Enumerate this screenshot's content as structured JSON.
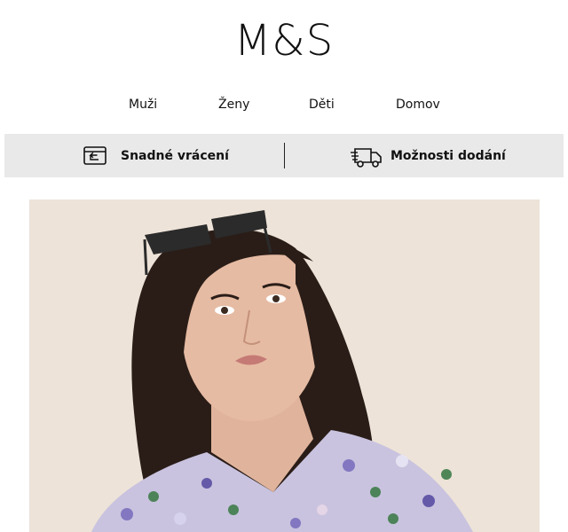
{
  "header": {
    "logo_text": "M&S"
  },
  "nav": {
    "items": [
      "Muži",
      "Ženy",
      "Děti",
      "Domov"
    ]
  },
  "banner": {
    "items": [
      {
        "label": "Snadné vrácení",
        "icon": "card-return-icon"
      },
      {
        "label": "Možnosti dodání",
        "icon": "delivery-truck-icon"
      }
    ],
    "background_color": "#e9e9e9"
  },
  "hero": {
    "image": "woman-in-floral-shirt-with-sunglasses-on-head",
    "background_color": "#ede3d8"
  }
}
